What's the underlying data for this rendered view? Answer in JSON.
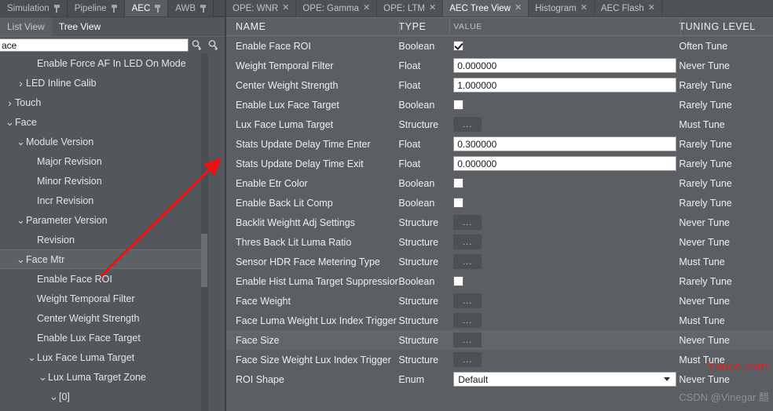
{
  "left_panel": {
    "module_tabs": [
      {
        "label": "Simulation",
        "active": false,
        "pinned": true
      },
      {
        "label": "Pipeline",
        "active": false,
        "pinned": true
      },
      {
        "label": "AEC",
        "active": true,
        "pinned": true
      },
      {
        "label": "AWB",
        "active": false,
        "pinned": true
      }
    ],
    "view_tabs": [
      {
        "label": "List View",
        "active": false
      },
      {
        "label": "Tree View",
        "active": true
      }
    ],
    "search": {
      "value": "ace",
      "placeholder": "",
      "find_prev_icon": "search-up-icon",
      "find_next_icon": "search-down-icon"
    },
    "tree": [
      {
        "label": "Enable Force AF In LED On Mode",
        "indent": 2,
        "arrow": "none",
        "selected": false
      },
      {
        "label": "LED Inline Calib",
        "indent": 1,
        "arrow": "collapsed",
        "selected": false
      },
      {
        "label": "Touch",
        "indent": 0,
        "arrow": "collapsed",
        "selected": false
      },
      {
        "label": "Face",
        "indent": 0,
        "arrow": "expanded",
        "selected": false
      },
      {
        "label": "Module Version",
        "indent": 1,
        "arrow": "expanded",
        "selected": false
      },
      {
        "label": "Major Revision",
        "indent": 2,
        "arrow": "none",
        "selected": false
      },
      {
        "label": "Minor Revision",
        "indent": 2,
        "arrow": "none",
        "selected": false
      },
      {
        "label": "Incr Revision",
        "indent": 2,
        "arrow": "none",
        "selected": false
      },
      {
        "label": "Parameter Version",
        "indent": 1,
        "arrow": "expanded",
        "selected": false
      },
      {
        "label": "Revision",
        "indent": 2,
        "arrow": "none",
        "selected": false
      },
      {
        "label": "Face Mtr",
        "indent": 1,
        "arrow": "expanded",
        "selected": true
      },
      {
        "label": "Enable Face ROI",
        "indent": 2,
        "arrow": "none",
        "selected": false
      },
      {
        "label": "Weight Temporal Filter",
        "indent": 2,
        "arrow": "none",
        "selected": false
      },
      {
        "label": "Center Weight Strength",
        "indent": 2,
        "arrow": "none",
        "selected": false
      },
      {
        "label": "Enable Lux Face Target",
        "indent": 2,
        "arrow": "none",
        "selected": false
      },
      {
        "label": "Lux Face Luma Target",
        "indent": 2,
        "arrow": "expanded",
        "selected": false
      },
      {
        "label": "Lux Luma Target Zone",
        "indent": 3,
        "arrow": "expanded",
        "selected": false
      },
      {
        "label": "[0]",
        "indent": 4,
        "arrow": "expanded",
        "selected": false
      }
    ]
  },
  "right_panel": {
    "tabs": [
      {
        "label": "OPE: WNR",
        "active": false,
        "close_icon": "close-icon"
      },
      {
        "label": "OPE: Gamma",
        "active": false,
        "close_icon": "close-icon"
      },
      {
        "label": "OPE: LTM",
        "active": false,
        "close_icon": "close-icon"
      },
      {
        "label": "AEC Tree View",
        "active": true,
        "close_icon": "close-icon"
      },
      {
        "label": "Histogram",
        "active": false,
        "close_icon": "close-icon"
      },
      {
        "label": "AEC Flash",
        "active": false,
        "close_icon": "close-icon"
      }
    ],
    "columns": {
      "name": "NAME",
      "type": "TYPE",
      "value": "VALUE",
      "tuning_level": "TUNING LEVEL"
    },
    "rows": [
      {
        "name": "Enable Face ROI",
        "type": "Boolean",
        "control": "checkbox",
        "value": "true",
        "tuning": "Often Tune",
        "alt": false
      },
      {
        "name": "Weight Temporal Filter",
        "type": "Float",
        "control": "textbox",
        "value": "0.000000",
        "tuning": "Never Tune",
        "alt": false
      },
      {
        "name": "Center Weight Strength",
        "type": "Float",
        "control": "textbox",
        "value": "1.000000",
        "tuning": "Rarely Tune",
        "alt": false
      },
      {
        "name": "Enable Lux Face Target",
        "type": "Boolean",
        "control": "checkbox",
        "value": "false",
        "tuning": "Rarely Tune",
        "alt": false
      },
      {
        "name": "Lux Face Luma Target",
        "type": "Structure",
        "control": "dots",
        "value": "...",
        "tuning": "Must Tune",
        "alt": false
      },
      {
        "name": "Stats Update Delay Time Enter",
        "type": "Float",
        "control": "textbox",
        "value": "0.300000",
        "tuning": "Rarely Tune",
        "alt": false
      },
      {
        "name": "Stats Update Delay Time Exit",
        "type": "Float",
        "control": "textbox",
        "value": "0.000000",
        "tuning": "Rarely Tune",
        "alt": false
      },
      {
        "name": "Enable Etr Color",
        "type": "Boolean",
        "control": "checkbox",
        "value": "false",
        "tuning": "Rarely Tune",
        "alt": false
      },
      {
        "name": "Enable Back Lit Comp",
        "type": "Boolean",
        "control": "checkbox",
        "value": "false",
        "tuning": "Rarely Tune",
        "alt": false
      },
      {
        "name": "Backlit Weightt Adj Settings",
        "type": "Structure",
        "control": "dots",
        "value": "...",
        "tuning": "Never Tune",
        "alt": false
      },
      {
        "name": "Thres Back Lit Luma Ratio",
        "type": "Structure",
        "control": "dots",
        "value": "...",
        "tuning": "Never Tune",
        "alt": false
      },
      {
        "name": "Sensor HDR Face Metering Type",
        "type": "Structure",
        "control": "dots",
        "value": "...",
        "tuning": "Must Tune",
        "alt": false
      },
      {
        "name": "Enable Hist Luma Target Suppression",
        "type": "Boolean",
        "control": "checkbox",
        "value": "false",
        "tuning": "Rarely Tune",
        "alt": false
      },
      {
        "name": "Face Weight",
        "type": "Structure",
        "control": "dots",
        "value": "...",
        "tuning": "Never Tune",
        "alt": false
      },
      {
        "name": "Face Luma Weight Lux Index Trigger",
        "type": "Structure",
        "control": "dots",
        "value": "...",
        "tuning": "Must Tune",
        "alt": false
      },
      {
        "name": "Face Size",
        "type": "Structure",
        "control": "dots",
        "value": "...",
        "tuning": "Never Tune",
        "alt": true
      },
      {
        "name": "Face Size Weight Lux Index Trigger",
        "type": "Structure",
        "control": "dots",
        "value": "...",
        "tuning": "Must Tune",
        "alt": false
      },
      {
        "name": "ROI Shape",
        "type": "Enum",
        "control": "combo",
        "value": "Default",
        "tuning": "Never Tune",
        "alt": false
      }
    ]
  },
  "annotations": {
    "arrow_color": "#ee1111"
  },
  "watermarks": {
    "red": "Yuucn.com",
    "grey": "CSDN @Vinegar 醋"
  },
  "colors": {
    "panel_bg": "#53575b",
    "grid_bg": "#5b5f63",
    "tab_bg": "#4e5256",
    "tab_active": "#5e6266",
    "text": "#efefef",
    "accent_red": "#ee1111"
  }
}
